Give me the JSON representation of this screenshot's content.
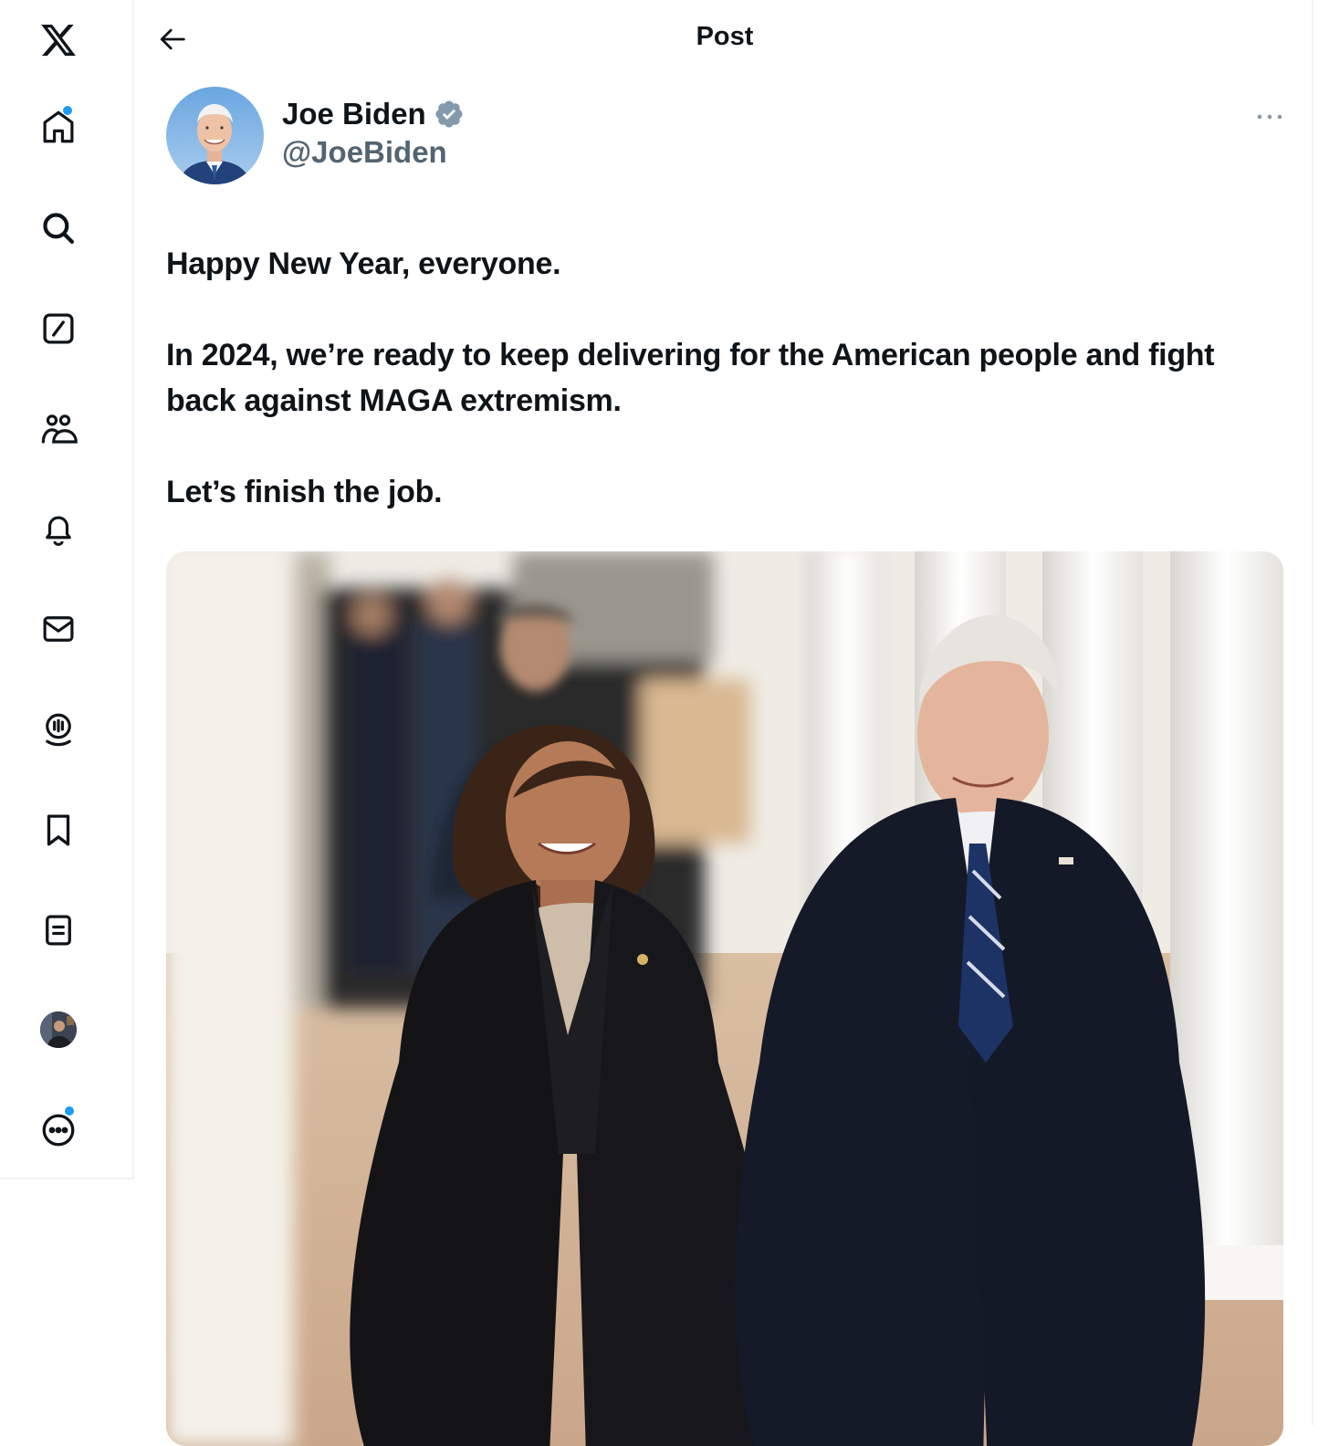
{
  "sidebar": {
    "items": [
      {
        "name": "x-logo",
        "icon": "x-logo-icon"
      },
      {
        "name": "home",
        "icon": "home-icon",
        "badge": true
      },
      {
        "name": "explore",
        "icon": "search-icon"
      },
      {
        "name": "grok",
        "icon": "grok-icon"
      },
      {
        "name": "communities",
        "icon": "communities-icon"
      },
      {
        "name": "notifications",
        "icon": "bell-icon"
      },
      {
        "name": "messages",
        "icon": "envelope-icon"
      },
      {
        "name": "spaces",
        "icon": "microphone-icon"
      },
      {
        "name": "bookmarks",
        "icon": "bookmark-icon"
      },
      {
        "name": "lists",
        "icon": "list-icon"
      },
      {
        "name": "profile",
        "icon": "profile-avatar"
      },
      {
        "name": "more",
        "icon": "more-circle-icon",
        "badge": true
      }
    ],
    "badge_color": "#1d9bf0"
  },
  "header": {
    "title": "Post"
  },
  "post": {
    "author_name": "Joe Biden",
    "handle": "@JoeBiden",
    "verified": true,
    "verified_color": "#829aab",
    "paragraphs": [
      "Happy New Year, everyone.",
      "In 2024, we’re ready to keep delivering for the American people and fight back against MAGA extremism.",
      "Let’s finish the job."
    ]
  },
  "colors": {
    "text": "#0f1419",
    "secondary": "#536471",
    "border": "#eff3f4"
  }
}
